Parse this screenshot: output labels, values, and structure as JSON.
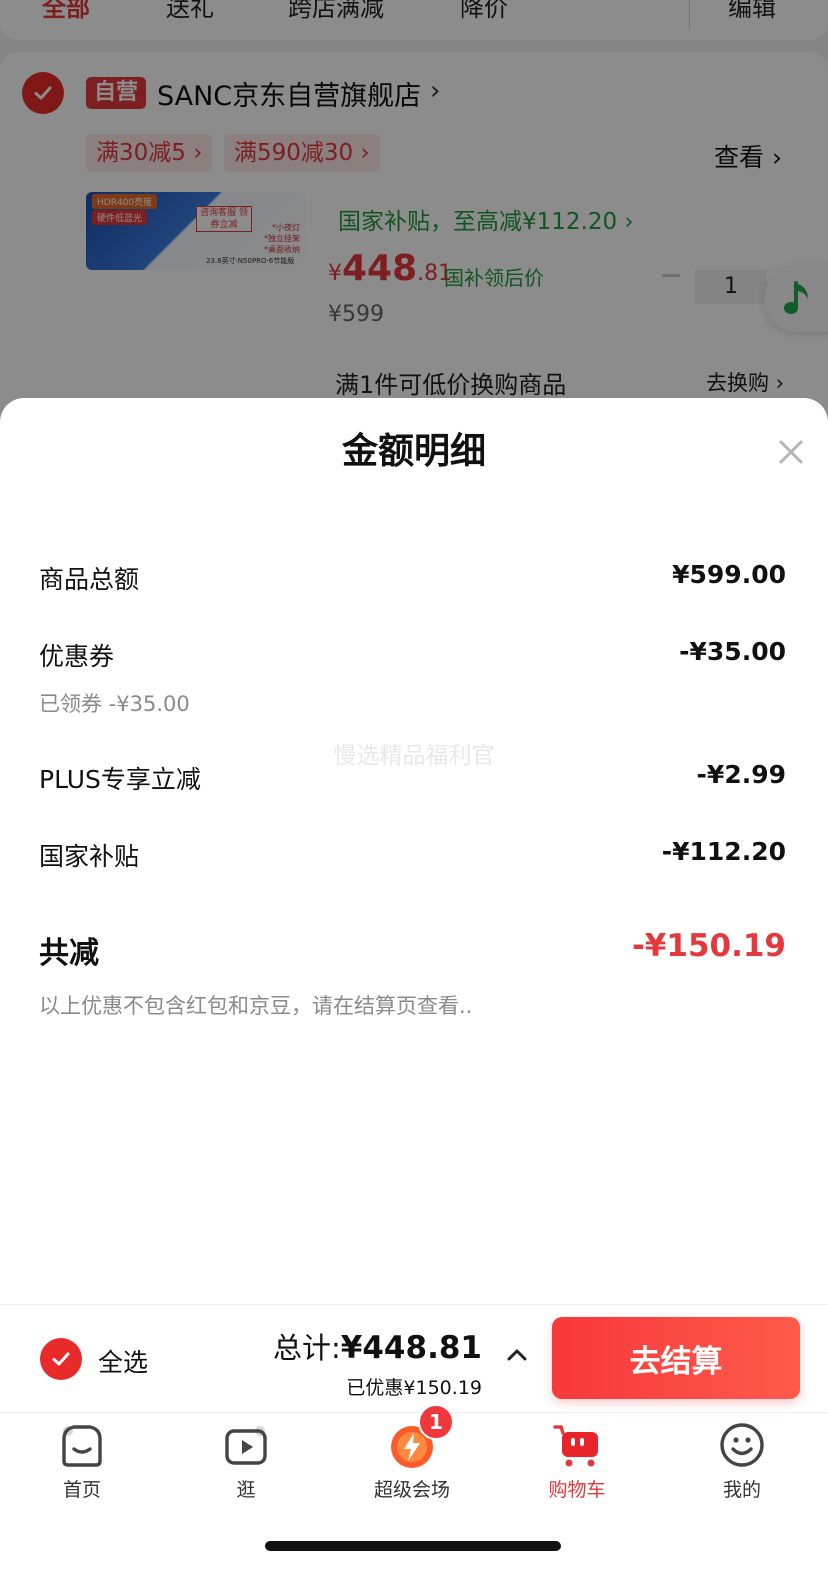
{
  "background": {
    "tabs": [
      "全部",
      "送礼",
      "跨店满减",
      "降价"
    ],
    "edit_label": "编辑",
    "shop": {
      "badge": "自营",
      "name": "SANC京东自营旗舰店",
      "promos": [
        "满30减5 ›",
        "满590减30 ›"
      ],
      "view_label": "查看 ›"
    },
    "product": {
      "image_texts": [
        "HDR400亮度",
        "硬件低蓝光",
        "咨询客服\n领券立减",
        "*小夜灯",
        "*独立挂架",
        "*桌面收纳",
        "23.8英寸·N50PRO·6节能版"
      ],
      "subsidy_text": "国家补贴，至高减¥112.20 ›",
      "price_yen": "¥",
      "price_int": "448",
      "price_dec": ".81",
      "price_label": "国补领后价",
      "original_price": "¥599",
      "quantity": "1"
    },
    "swap": {
      "text": "满1件可低价换购商品",
      "link": "去换购 ›"
    }
  },
  "sheet": {
    "title": "金额明细",
    "rows": [
      {
        "label": "商品总额",
        "value": "¥599.00"
      },
      {
        "label": "优惠券",
        "value": "-¥35.00",
        "sub": "已领券 -¥35.00"
      },
      {
        "label": "PLUS专享立减",
        "value": "-¥2.99"
      },
      {
        "label": "国家补贴",
        "value": "-¥112.20"
      }
    ],
    "watermark": "慢选精品福利官",
    "total_label": "共减",
    "total_value": "-¥150.19",
    "note": "以上优惠不包含红包和京豆，请在结算页查看.."
  },
  "checkout": {
    "select_all": "全选",
    "total_label": "总计:",
    "total_value": "¥448.81",
    "saved": "已优惠¥150.19",
    "button": "去结算"
  },
  "tabbar": {
    "items": [
      {
        "label": "首页",
        "icon": "home-icon"
      },
      {
        "label": "逛",
        "icon": "video-play-icon"
      },
      {
        "label": "超级会场",
        "icon": "super-venue-icon"
      },
      {
        "label": "购物车",
        "icon": "cart-icon"
      },
      {
        "label": "我的",
        "icon": "profile-smile-icon"
      }
    ],
    "badge": "1"
  },
  "colors": {
    "accent": "#e4393c",
    "subsidy_green": "#1e9a3a",
    "check_red": "#e82a2a"
  }
}
